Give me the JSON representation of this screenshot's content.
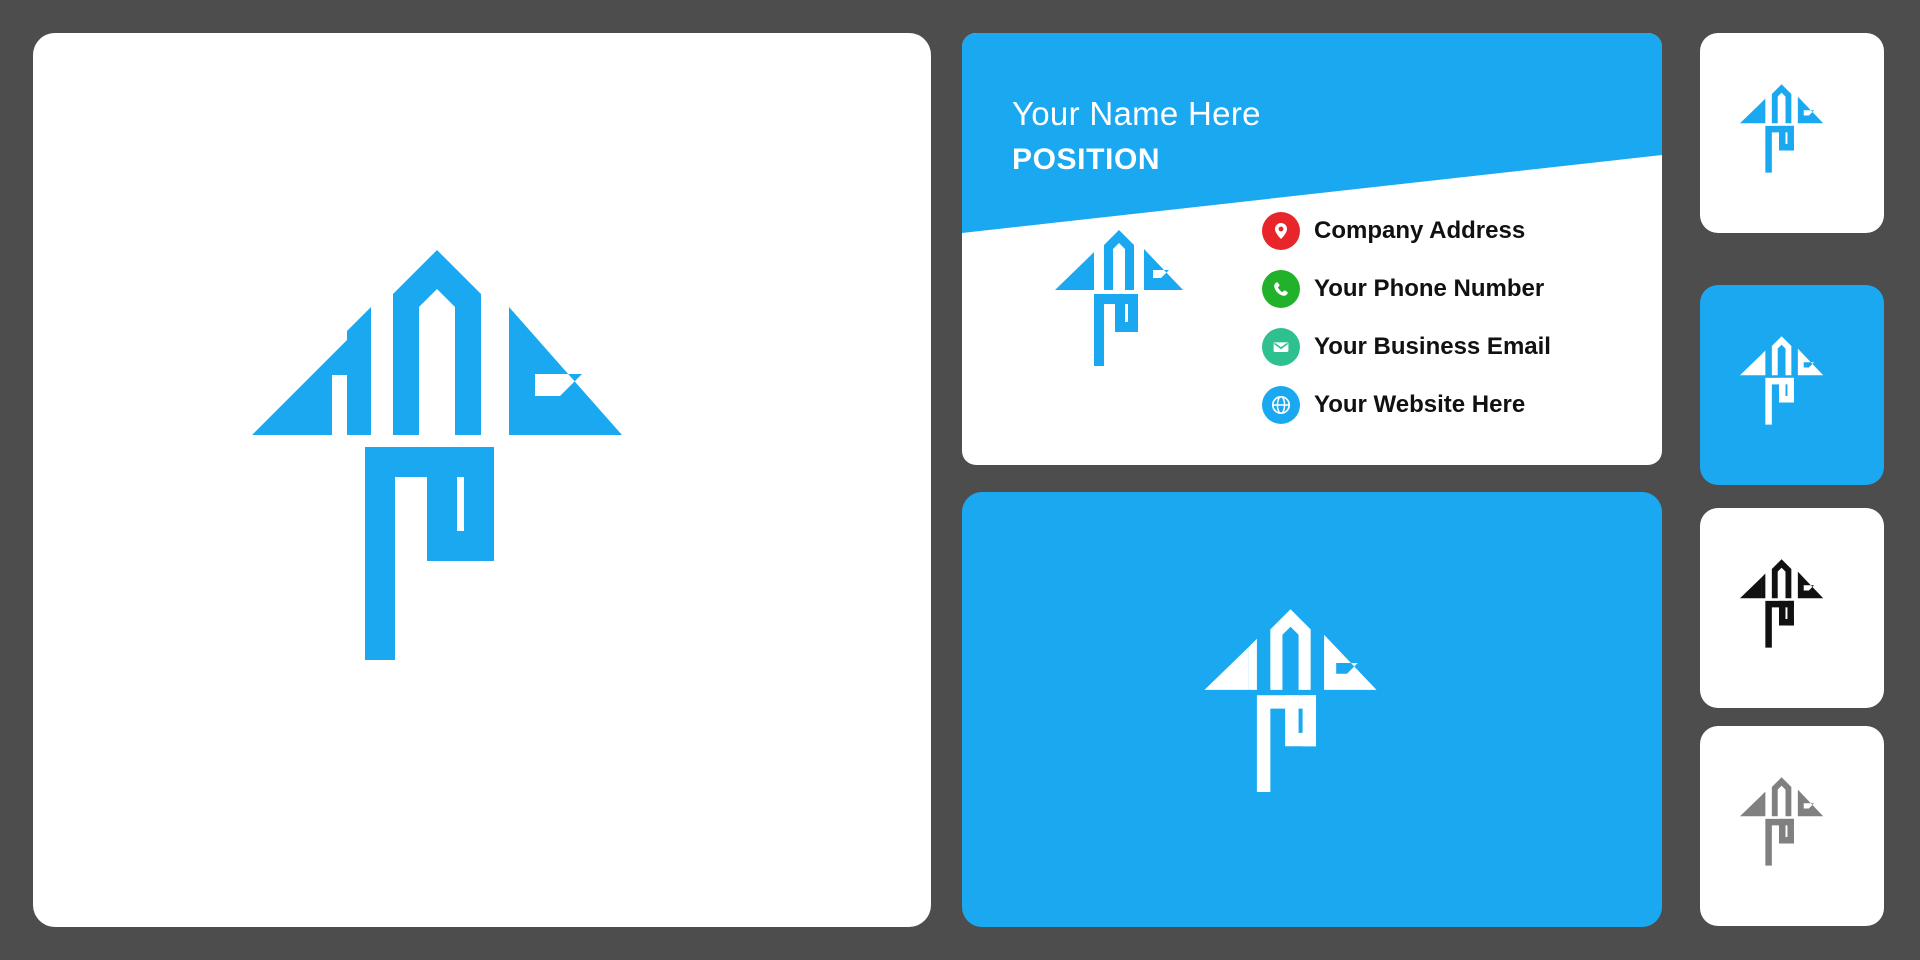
{
  "brand": {
    "accent": "#1aa9f0",
    "white": "#ffffff",
    "black": "#111111",
    "gray": "#808080",
    "background": "#4d4d4d"
  },
  "main_panel": {
    "logo_name": "arrow-house-tp-logo",
    "logo_color": "#1aa9f0"
  },
  "business_card": {
    "name": "Your Name Here",
    "position": "POSITION",
    "logo_color": "#1aa9f0",
    "band_color": "#1aa9f0",
    "contacts": [
      {
        "icon": "location-pin-icon",
        "icon_color": "#e8252a",
        "label": "Company Address"
      },
      {
        "icon": "phone-icon",
        "icon_color": "#21b12b",
        "label": "Your Phone Number"
      },
      {
        "icon": "envelope-icon",
        "icon_color": "#2fc08f",
        "label": "Your Business Email"
      },
      {
        "icon": "globe-icon",
        "icon_color": "#1aa9f0",
        "label": "Your Website Here"
      }
    ]
  },
  "blue_card": {
    "background": "#1aa9f0",
    "logo_color": "#ffffff",
    "logo_name": "arrow-house-tp-logo-white"
  },
  "thumbnails": [
    {
      "name": "thumbnail-blue-on-white",
      "background": "#ffffff",
      "logo_color": "#1aa9f0"
    },
    {
      "name": "thumbnail-white-on-blue",
      "background": "#1aa9f0",
      "logo_color": "#ffffff"
    },
    {
      "name": "thumbnail-black-on-white",
      "background": "#ffffff",
      "logo_color": "#111111"
    },
    {
      "name": "thumbnail-gray-on-white",
      "background": "#ffffff",
      "logo_color": "#808080"
    }
  ]
}
